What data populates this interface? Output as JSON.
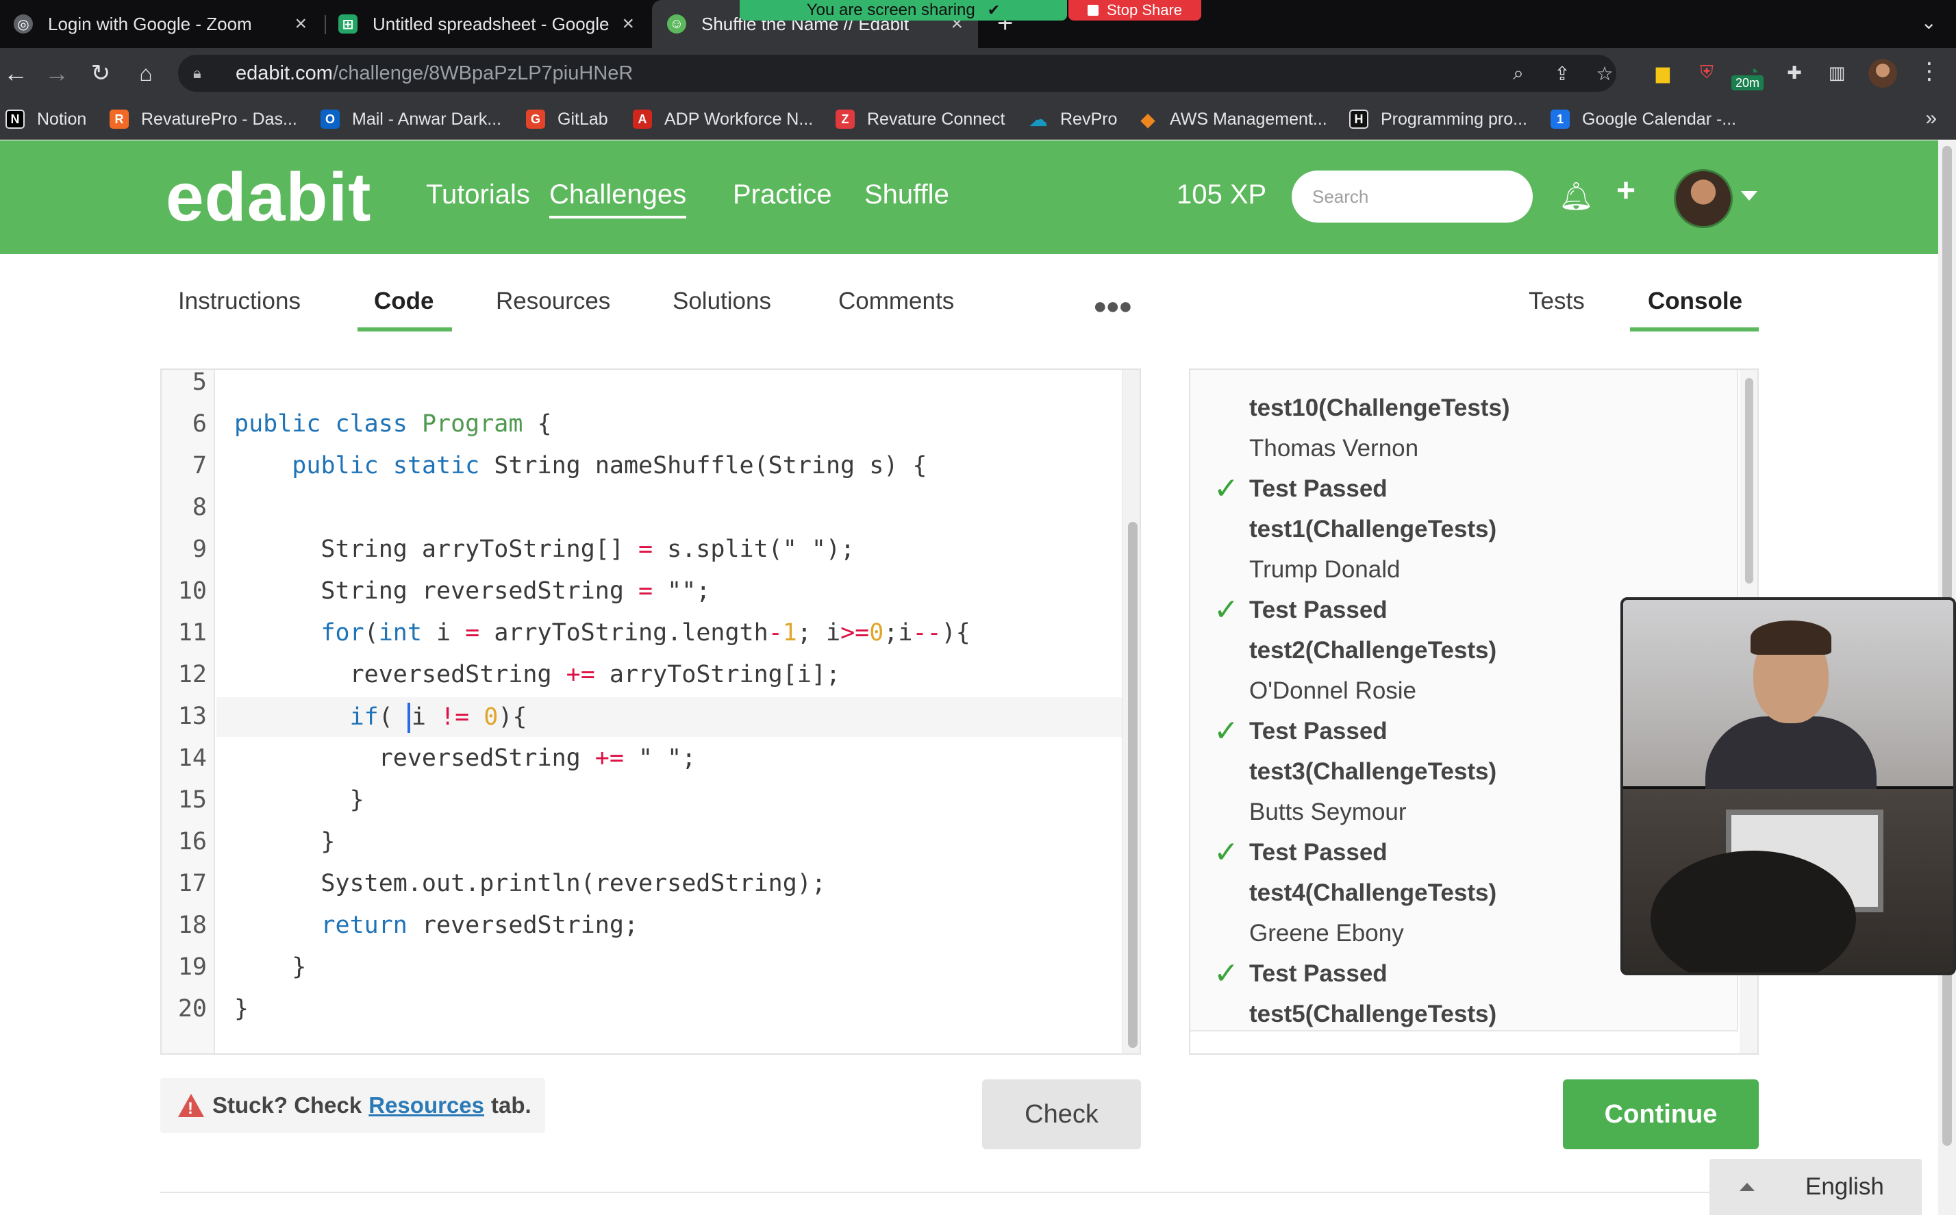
{
  "browser": {
    "tabs": [
      {
        "label": "Login with Google - Zoom",
        "icon": "globe-icon"
      },
      {
        "label": "Untitled spreadsheet - Google",
        "icon": "sheets-icon"
      },
      {
        "label": "Shuffle the Name // Edabit",
        "icon": "edabit-icon"
      }
    ],
    "share_banner": "You are screen sharing",
    "stop_share": "Stop Share",
    "url_host": "edabit.com",
    "url_path": "/challenge/8WBpaPzLP7piuHNeR",
    "ext_badge": "20m",
    "bookmarks": [
      {
        "label": "Notion",
        "color": "#000000",
        "glyph": "N"
      },
      {
        "label": "RevaturePro - Das...",
        "color": "#f26925",
        "glyph": "R"
      },
      {
        "label": "Mail - Anwar Dark...",
        "color": "#0a64c8",
        "glyph": "O"
      },
      {
        "label": "GitLab",
        "color": "#e24329",
        "glyph": "G"
      },
      {
        "label": "ADP Workforce N...",
        "color": "#d0271d",
        "glyph": "A"
      },
      {
        "label": "Revature Connect",
        "color": "#e0393e",
        "glyph": "Z"
      },
      {
        "label": "RevPro",
        "color": "#1798c1",
        "glyph": "☁"
      },
      {
        "label": "AWS Management...",
        "color": "#f0861f",
        "glyph": "◆"
      },
      {
        "label": "Programming pro...",
        "color": "#111111",
        "glyph": "H"
      },
      {
        "label": "Google Calendar -...",
        "color": "#1a73e8",
        "glyph": "1"
      }
    ]
  },
  "site": {
    "logo": "edabit",
    "nav": [
      "Tutorials",
      "Challenges",
      "Practice",
      "Shuffle"
    ],
    "xp": "105 XP",
    "search_placeholder": "Search"
  },
  "subtabs": {
    "left": [
      "Instructions",
      "Code",
      "Resources",
      "Solutions",
      "Comments"
    ],
    "right": [
      "Tests",
      "Console"
    ]
  },
  "editor": {
    "line_numbers": [
      "5",
      "6",
      "7",
      "8",
      "9",
      "10",
      "11",
      "12",
      "13",
      "14",
      "15",
      "16",
      "17",
      "18",
      "19",
      "20"
    ],
    "active_line": "13"
  },
  "console": {
    "lines": [
      {
        "text": "test10(ChallengeTests)",
        "bold": true,
        "check": false
      },
      {
        "text": "Thomas Vernon",
        "bold": false,
        "check": false
      },
      {
        "text": "Test Passed",
        "bold": true,
        "check": true
      },
      {
        "text": "test1(ChallengeTests)",
        "bold": true,
        "check": false
      },
      {
        "text": "Trump Donald",
        "bold": false,
        "check": false
      },
      {
        "text": "Test Passed",
        "bold": true,
        "check": true
      },
      {
        "text": "test2(ChallengeTests)",
        "bold": true,
        "check": false
      },
      {
        "text": "O'Donnel Rosie",
        "bold": false,
        "check": false
      },
      {
        "text": "Test Passed",
        "bold": true,
        "check": true
      },
      {
        "text": "test3(ChallengeTests)",
        "bold": true,
        "check": false
      },
      {
        "text": "Butts Seymour",
        "bold": false,
        "check": false
      },
      {
        "text": "Test Passed",
        "bold": true,
        "check": true
      },
      {
        "text": "test4(ChallengeTests)",
        "bold": true,
        "check": false
      },
      {
        "text": "Greene Ebony",
        "bold": false,
        "check": false
      },
      {
        "text": "Test Passed",
        "bold": true,
        "check": true
      },
      {
        "text": "test5(ChallengeTests)",
        "bold": true,
        "check": false
      }
    ]
  },
  "footer": {
    "stuck_prefix": "Stuck? Check",
    "stuck_link": "Resources",
    "stuck_suffix": "tab.",
    "check": "Check",
    "continue": "Continue",
    "language": "English"
  },
  "colors": {
    "brand_green": "#5cb85c",
    "continue_green": "#4cb050",
    "pass_green": "#3aa33a",
    "warning_red": "#d9534f"
  }
}
